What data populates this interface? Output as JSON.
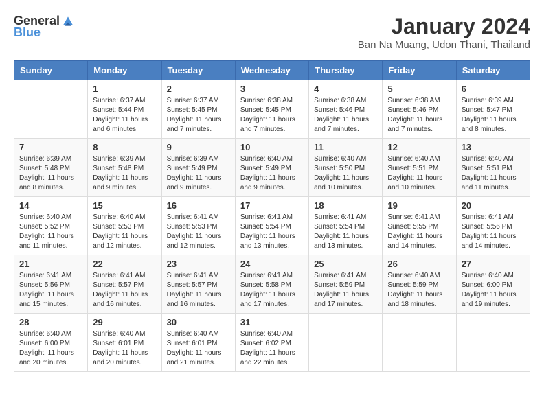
{
  "header": {
    "logo_general": "General",
    "logo_blue": "Blue",
    "title": "January 2024",
    "subtitle": "Ban Na Muang, Udon Thani, Thailand"
  },
  "calendar": {
    "days_of_week": [
      "Sunday",
      "Monday",
      "Tuesday",
      "Wednesday",
      "Thursday",
      "Friday",
      "Saturday"
    ],
    "weeks": [
      [
        {
          "day": "",
          "info": ""
        },
        {
          "day": "1",
          "info": "Sunrise: 6:37 AM\nSunset: 5:44 PM\nDaylight: 11 hours\nand 6 minutes."
        },
        {
          "day": "2",
          "info": "Sunrise: 6:37 AM\nSunset: 5:45 PM\nDaylight: 11 hours\nand 7 minutes."
        },
        {
          "day": "3",
          "info": "Sunrise: 6:38 AM\nSunset: 5:45 PM\nDaylight: 11 hours\nand 7 minutes."
        },
        {
          "day": "4",
          "info": "Sunrise: 6:38 AM\nSunset: 5:46 PM\nDaylight: 11 hours\nand 7 minutes."
        },
        {
          "day": "5",
          "info": "Sunrise: 6:38 AM\nSunset: 5:46 PM\nDaylight: 11 hours\nand 7 minutes."
        },
        {
          "day": "6",
          "info": "Sunrise: 6:39 AM\nSunset: 5:47 PM\nDaylight: 11 hours\nand 8 minutes."
        }
      ],
      [
        {
          "day": "7",
          "info": "Sunrise: 6:39 AM\nSunset: 5:48 PM\nDaylight: 11 hours\nand 8 minutes."
        },
        {
          "day": "8",
          "info": "Sunrise: 6:39 AM\nSunset: 5:48 PM\nDaylight: 11 hours\nand 9 minutes."
        },
        {
          "day": "9",
          "info": "Sunrise: 6:39 AM\nSunset: 5:49 PM\nDaylight: 11 hours\nand 9 minutes."
        },
        {
          "day": "10",
          "info": "Sunrise: 6:40 AM\nSunset: 5:49 PM\nDaylight: 11 hours\nand 9 minutes."
        },
        {
          "day": "11",
          "info": "Sunrise: 6:40 AM\nSunset: 5:50 PM\nDaylight: 11 hours\nand 10 minutes."
        },
        {
          "day": "12",
          "info": "Sunrise: 6:40 AM\nSunset: 5:51 PM\nDaylight: 11 hours\nand 10 minutes."
        },
        {
          "day": "13",
          "info": "Sunrise: 6:40 AM\nSunset: 5:51 PM\nDaylight: 11 hours\nand 11 minutes."
        }
      ],
      [
        {
          "day": "14",
          "info": "Sunrise: 6:40 AM\nSunset: 5:52 PM\nDaylight: 11 hours\nand 11 minutes."
        },
        {
          "day": "15",
          "info": "Sunrise: 6:40 AM\nSunset: 5:53 PM\nDaylight: 11 hours\nand 12 minutes."
        },
        {
          "day": "16",
          "info": "Sunrise: 6:41 AM\nSunset: 5:53 PM\nDaylight: 11 hours\nand 12 minutes."
        },
        {
          "day": "17",
          "info": "Sunrise: 6:41 AM\nSunset: 5:54 PM\nDaylight: 11 hours\nand 13 minutes."
        },
        {
          "day": "18",
          "info": "Sunrise: 6:41 AM\nSunset: 5:54 PM\nDaylight: 11 hours\nand 13 minutes."
        },
        {
          "day": "19",
          "info": "Sunrise: 6:41 AM\nSunset: 5:55 PM\nDaylight: 11 hours\nand 14 minutes."
        },
        {
          "day": "20",
          "info": "Sunrise: 6:41 AM\nSunset: 5:56 PM\nDaylight: 11 hours\nand 14 minutes."
        }
      ],
      [
        {
          "day": "21",
          "info": "Sunrise: 6:41 AM\nSunset: 5:56 PM\nDaylight: 11 hours\nand 15 minutes."
        },
        {
          "day": "22",
          "info": "Sunrise: 6:41 AM\nSunset: 5:57 PM\nDaylight: 11 hours\nand 16 minutes."
        },
        {
          "day": "23",
          "info": "Sunrise: 6:41 AM\nSunset: 5:57 PM\nDaylight: 11 hours\nand 16 minutes."
        },
        {
          "day": "24",
          "info": "Sunrise: 6:41 AM\nSunset: 5:58 PM\nDaylight: 11 hours\nand 17 minutes."
        },
        {
          "day": "25",
          "info": "Sunrise: 6:41 AM\nSunset: 5:59 PM\nDaylight: 11 hours\nand 17 minutes."
        },
        {
          "day": "26",
          "info": "Sunrise: 6:40 AM\nSunset: 5:59 PM\nDaylight: 11 hours\nand 18 minutes."
        },
        {
          "day": "27",
          "info": "Sunrise: 6:40 AM\nSunset: 6:00 PM\nDaylight: 11 hours\nand 19 minutes."
        }
      ],
      [
        {
          "day": "28",
          "info": "Sunrise: 6:40 AM\nSunset: 6:00 PM\nDaylight: 11 hours\nand 20 minutes."
        },
        {
          "day": "29",
          "info": "Sunrise: 6:40 AM\nSunset: 6:01 PM\nDaylight: 11 hours\nand 20 minutes."
        },
        {
          "day": "30",
          "info": "Sunrise: 6:40 AM\nSunset: 6:01 PM\nDaylight: 11 hours\nand 21 minutes."
        },
        {
          "day": "31",
          "info": "Sunrise: 6:40 AM\nSunset: 6:02 PM\nDaylight: 11 hours\nand 22 minutes."
        },
        {
          "day": "",
          "info": ""
        },
        {
          "day": "",
          "info": ""
        },
        {
          "day": "",
          "info": ""
        }
      ]
    ]
  }
}
